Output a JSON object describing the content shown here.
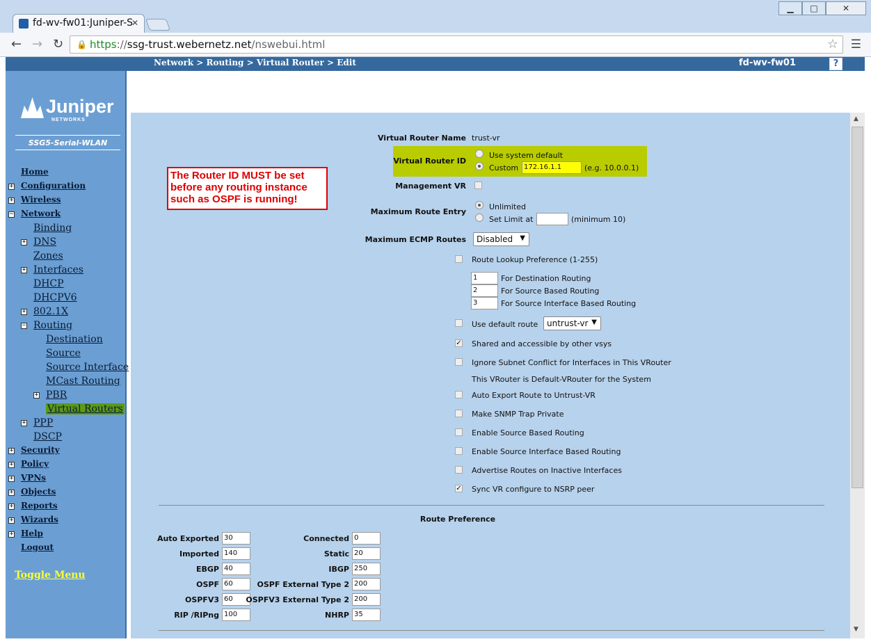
{
  "browser": {
    "tab_title": "fd-wv-fw01:Juniper-S",
    "url_https": "https",
    "url_host": "ssg-trust.webernetz.net",
    "url_path": "/nswebui.html"
  },
  "header": {
    "breadcrumb": "Network > Routing > Virtual Router > Edit",
    "hostname": "fd-wv-fw01",
    "help": "?"
  },
  "sidebar": {
    "logo": "Juniper",
    "logo_sub": "NETWORKS",
    "model": "SSG5-Serial-WLAN",
    "toggle": "Toggle Menu",
    "items": [
      "Home",
      "Configuration",
      "Wireless",
      "Network",
      "Binding",
      "DNS",
      "Zones",
      "Interfaces",
      "DHCP",
      "DHCPV6",
      "802.1X",
      "Routing",
      "Destination",
      "Source",
      "Source Interface",
      "MCast Routing",
      "PBR",
      "Virtual Routers",
      "PPP",
      "DSCP",
      "Security",
      "Policy",
      "VPNs",
      "Objects",
      "Reports",
      "Wizards",
      "Help",
      "Logout"
    ]
  },
  "warning": "The Router ID MUST be set before any routing instance such as OSPF is running!",
  "form": {
    "vr_name_label": "Virtual Router Name",
    "vr_name": "trust-vr",
    "vr_id_label": "Virtual Router ID",
    "use_default": "Use system default",
    "custom": "Custom",
    "custom_value": "172.16.1.1",
    "custom_hint": "(e.g. 10.0.0.1)",
    "mgmt_vr": "Management VR",
    "max_route_label": "Maximum Route Entry",
    "unlimited": "Unlimited",
    "set_limit": "Set Limit at",
    "limit_hint": "(minimum 10)",
    "max_ecmp_label": "Maximum ECMP Routes",
    "ecmp_value": "Disabled",
    "route_lookup": "Route Lookup Preference (1-255)",
    "dest_val": "1",
    "dest_lbl": "For Destination Routing",
    "src_val": "2",
    "src_lbl": "For Source Based Routing",
    "srcif_val": "3",
    "srcif_lbl": "For Source Interface Based Routing",
    "use_default_route": "Use default route",
    "default_route_value": "untrust-vr",
    "shared": "Shared and accessible by other vsys",
    "ignore_subnet": "Ignore Subnet Conflict for Interfaces in This VRouter",
    "default_vrouter": "This VRouter is Default-VRouter for the System",
    "auto_export": "Auto Export Route to Untrust-VR",
    "snmp_private": "Make SNMP Trap Private",
    "enable_src": "Enable Source Based Routing",
    "enable_srcif": "Enable Source Interface Based Routing",
    "advertise": "Advertise Routes on Inactive Interfaces",
    "sync_vr": "Sync VR configure to NSRP peer"
  },
  "route_pref": {
    "title": "Route Preference",
    "left": [
      {
        "label": "Auto Exported",
        "value": "30"
      },
      {
        "label": "Imported",
        "value": "140"
      },
      {
        "label": "EBGP",
        "value": "40"
      },
      {
        "label": "OSPF",
        "value": "60"
      },
      {
        "label": "OSPFV3",
        "value": "60"
      },
      {
        "label": "RIP /RIPng",
        "value": "100"
      }
    ],
    "right": [
      {
        "label": "Connected",
        "value": "0"
      },
      {
        "label": "Static",
        "value": "20"
      },
      {
        "label": "IBGP",
        "value": "250"
      },
      {
        "label": "OSPF External Type 2",
        "value": "200"
      },
      {
        "label": "OSPFV3 External Type 2",
        "value": "200"
      },
      {
        "label": "NHRP",
        "value": "35"
      }
    ]
  }
}
